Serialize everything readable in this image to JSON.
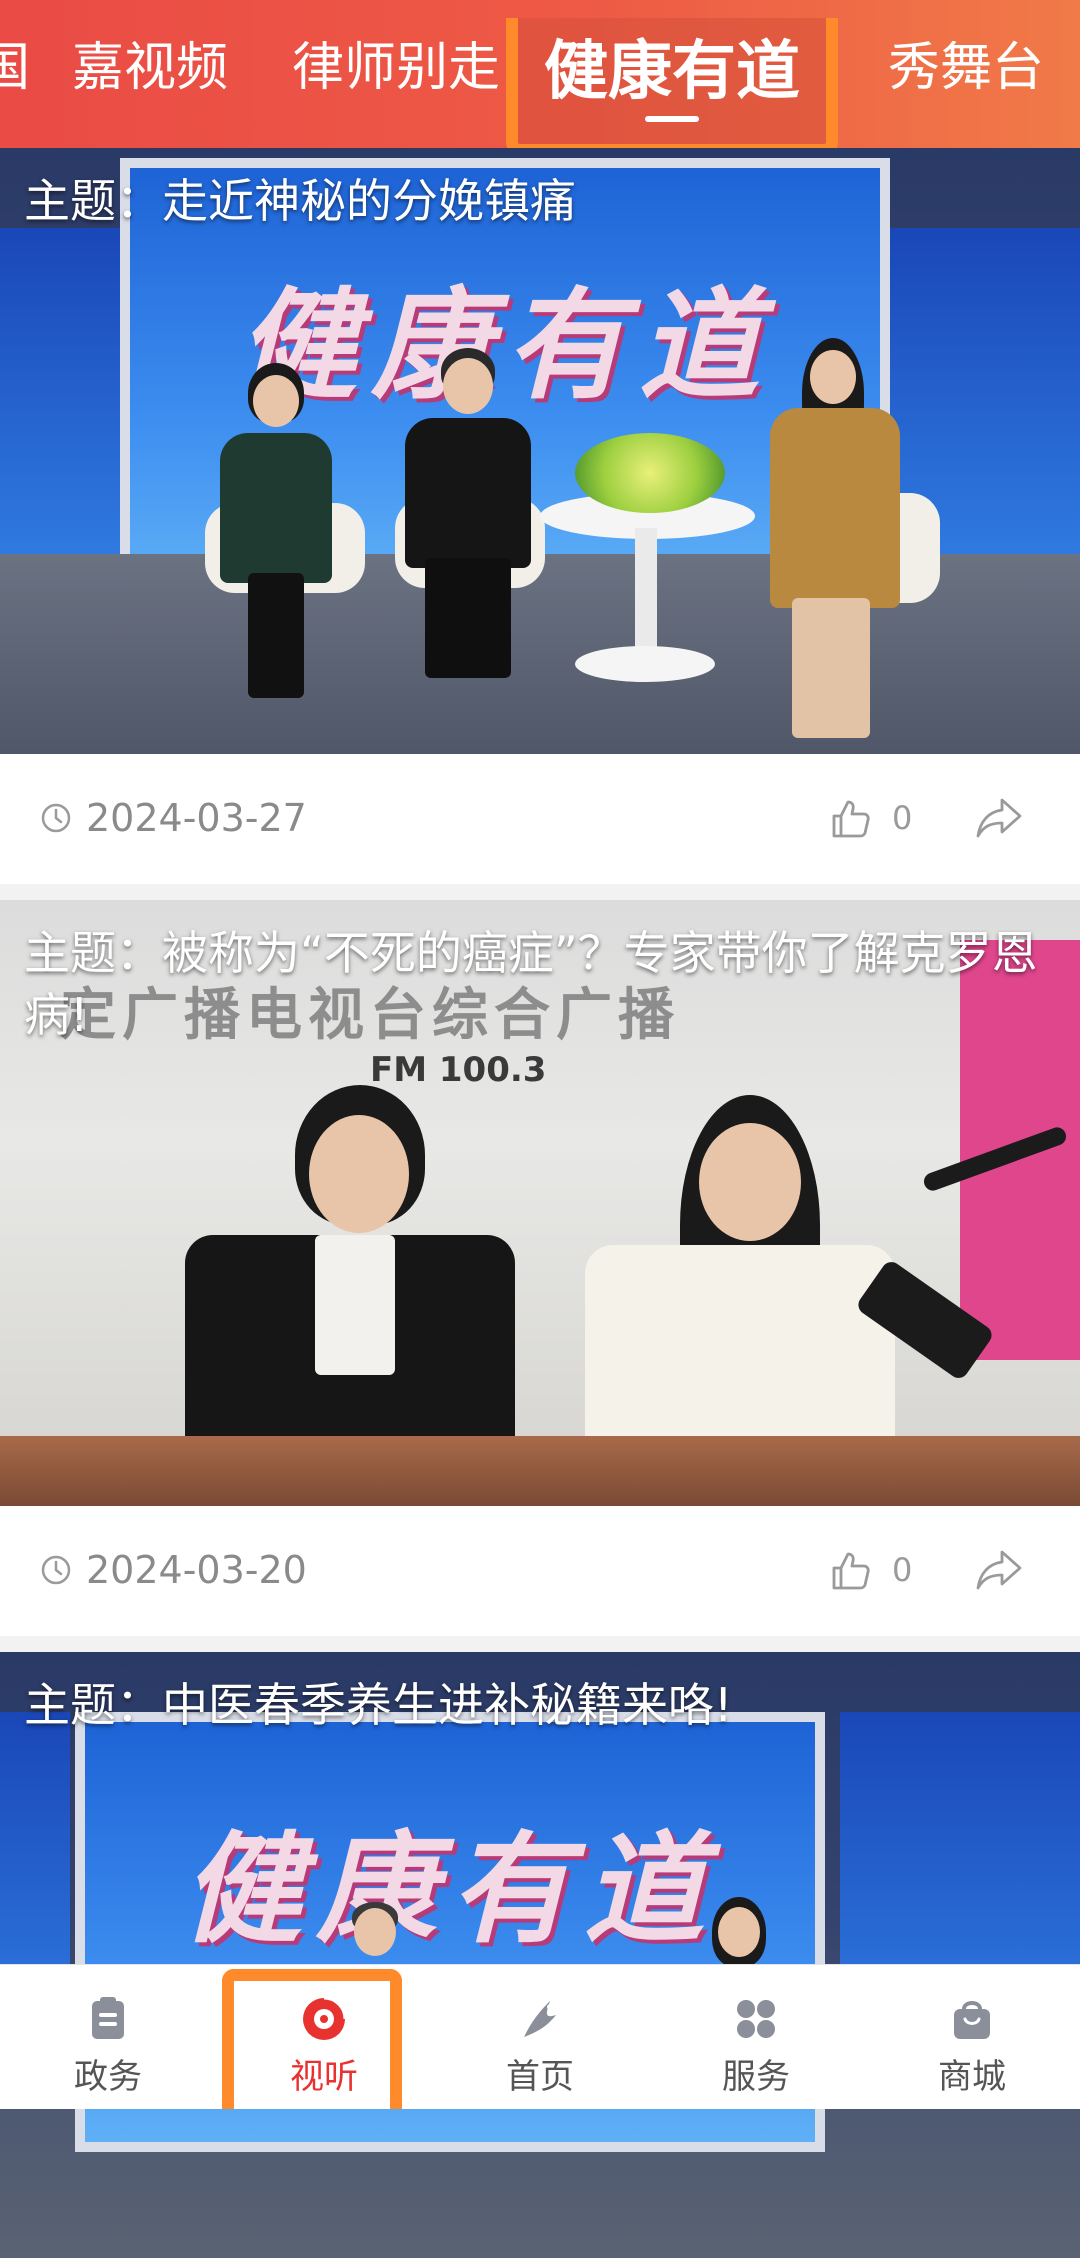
{
  "tabs": {
    "items": [
      {
        "label": "国"
      },
      {
        "label": "嘉视频"
      },
      {
        "label": "律师别走"
      },
      {
        "label": "健康有道",
        "active": true
      },
      {
        "label": "秀舞台"
      }
    ]
  },
  "feed": {
    "cards": [
      {
        "topic": "主题：走近神秘的分娩镇痛",
        "thumbnail_text": "健康有道",
        "date": "2024-03-27",
        "likes": "0"
      },
      {
        "topic": "主题：被称为“不死的癌症”？专家带你了解克罗恩病!",
        "thumbnail_text": "定广播电视台综合广播",
        "thumbnail_subtext": "FM 100.3",
        "date": "2024-03-20",
        "likes": "0"
      },
      {
        "topic": "主题：中医春季养生进补秘籍来咯!",
        "thumbnail_text": "健康有道"
      }
    ]
  },
  "bottom_nav": {
    "items": [
      {
        "label": "政务",
        "icon": "clipboard-icon"
      },
      {
        "label": "视听",
        "icon": "play-disc-icon",
        "active": true
      },
      {
        "label": "首页",
        "icon": "home-logo-icon"
      },
      {
        "label": "服务",
        "icon": "grid-icon"
      },
      {
        "label": "商城",
        "icon": "shopping-bag-icon"
      }
    ]
  },
  "colors": {
    "top_bar_start": "#ea4b45",
    "top_bar_end": "#f07a48",
    "highlight_box": "#ff8a2c",
    "active_nav": "#e8322f",
    "meta_text": "#8a8a8a"
  }
}
